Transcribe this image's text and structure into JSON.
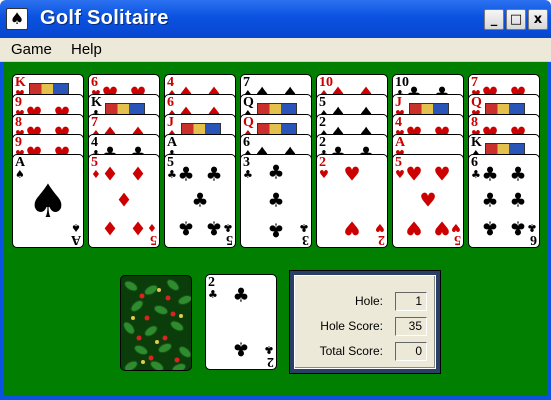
{
  "window": {
    "title": "Golf Solitaire",
    "icon": "spade-card-icon"
  },
  "title_buttons": {
    "minimize": "_",
    "maximize": "□",
    "close": "x"
  },
  "menu": {
    "items": [
      "Game",
      "Help"
    ]
  },
  "colors": {
    "felt": "#007f00",
    "red": "#c00000",
    "black": "#000000",
    "panel_border": "#2a3f66"
  },
  "tableau": [
    [
      {
        "rank": "K",
        "suit": "♥"
      },
      {
        "rank": "9",
        "suit": "♥"
      },
      {
        "rank": "8",
        "suit": "♥"
      },
      {
        "rank": "9",
        "suit": "♥"
      },
      {
        "rank": "A",
        "suit": "♠"
      }
    ],
    [
      {
        "rank": "6",
        "suit": "♥"
      },
      {
        "rank": "K",
        "suit": "♣"
      },
      {
        "rank": "7",
        "suit": "♦"
      },
      {
        "rank": "4",
        "suit": "♣"
      },
      {
        "rank": "5",
        "suit": "♦"
      }
    ],
    [
      {
        "rank": "4",
        "suit": "♦"
      },
      {
        "rank": "6",
        "suit": "♦"
      },
      {
        "rank": "J",
        "suit": "♦"
      },
      {
        "rank": "A",
        "suit": "♣"
      },
      {
        "rank": "5",
        "suit": "♣"
      }
    ],
    [
      {
        "rank": "7",
        "suit": "♠"
      },
      {
        "rank": "Q",
        "suit": "♠"
      },
      {
        "rank": "Q",
        "suit": "♦"
      },
      {
        "rank": "6",
        "suit": "♠"
      },
      {
        "rank": "3",
        "suit": "♣"
      }
    ],
    [
      {
        "rank": "10",
        "suit": "♦"
      },
      {
        "rank": "5",
        "suit": "♠"
      },
      {
        "rank": "2",
        "suit": "♠"
      },
      {
        "rank": "2",
        "suit": "♣"
      },
      {
        "rank": "2",
        "suit": "♥"
      }
    ],
    [
      {
        "rank": "10",
        "suit": "♣"
      },
      {
        "rank": "J",
        "suit": "♥"
      },
      {
        "rank": "4",
        "suit": "♥"
      },
      {
        "rank": "A",
        "suit": "♥"
      },
      {
        "rank": "5",
        "suit": "♥"
      }
    ],
    [
      {
        "rank": "7",
        "suit": "♥"
      },
      {
        "rank": "Q",
        "suit": "♥"
      },
      {
        "rank": "8",
        "suit": "♥"
      },
      {
        "rank": "K",
        "suit": "♠"
      },
      {
        "rank": "6",
        "suit": "♣"
      }
    ]
  ],
  "waste": {
    "rank": "2",
    "suit": "♣"
  },
  "stock": {
    "icon": "card-back-holly-pattern"
  },
  "score": {
    "hole_label": "Hole:",
    "hole_value": "1",
    "hole_score_label": "Hole Score:",
    "hole_score_value": "35",
    "total_score_label": "Total Score:",
    "total_score_value": "0"
  }
}
